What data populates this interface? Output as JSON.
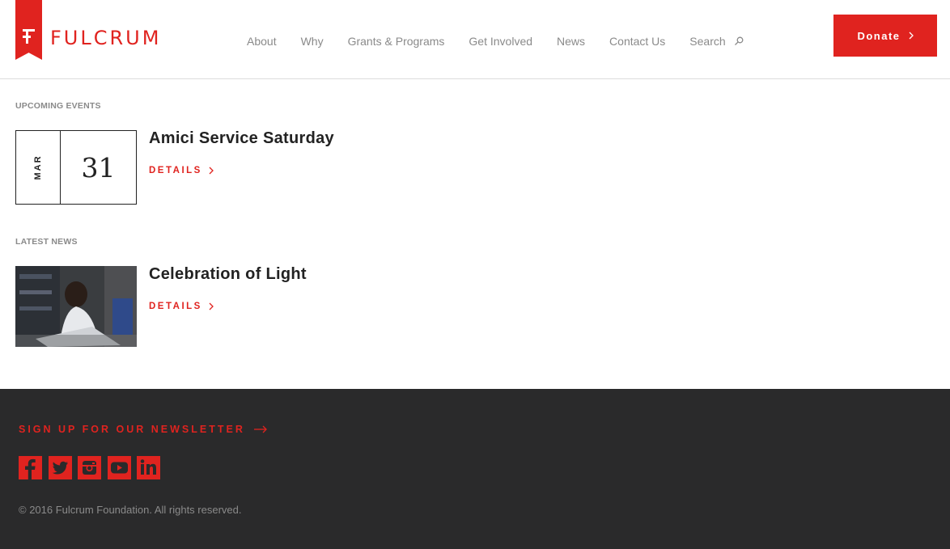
{
  "header": {
    "logo_text": "FULCRUM",
    "nav": [
      "About",
      "Why",
      "Grants & Programs",
      "Get Involved",
      "News",
      "Contact Us"
    ],
    "search_label": "Search",
    "donate_label": "Donate"
  },
  "events": {
    "section_label": "UPCOMING EVENTS",
    "month": "MAR",
    "day": "31",
    "title": "Amici Service Saturday",
    "details_label": "DETAILS"
  },
  "news": {
    "section_label": "LATEST NEWS",
    "title": "Celebration of Light",
    "details_label": "DETAILS"
  },
  "footer": {
    "newsletter_label": "SIGN UP FOR OUR NEWSLETTER",
    "socials": [
      "facebook-icon",
      "twitter-icon",
      "instagram-icon",
      "youtube-icon",
      "linkedin-icon"
    ],
    "copyright": "© 2016 Fulcrum Foundation. All rights reserved."
  },
  "colors": {
    "accent": "#e0231f",
    "footer_bg": "#2a2a2b",
    "nav_text": "#8a8a8a"
  }
}
